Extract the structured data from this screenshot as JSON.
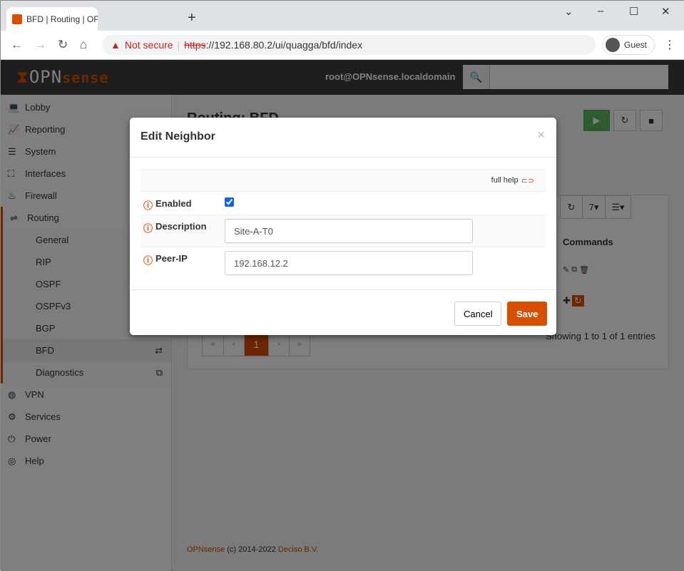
{
  "browser": {
    "tab_title": "BFD | Routing | OPNsense.localdc",
    "new_tab": "+",
    "not_secure": "Not secure",
    "url_scheme": "https",
    "url_rest": "://192.168.80.2/ui/quagga/bfd/index",
    "profile": "Guest"
  },
  "header": {
    "logo": "OPN",
    "logo_accent": "sense",
    "user": "root@OPNsense.localdomain",
    "search_placeholder": ""
  },
  "sidebar": {
    "items": [
      {
        "label": "Lobby",
        "icon": "laptop-icon",
        "glyph": "💻"
      },
      {
        "label": "Reporting",
        "icon": "chart-icon",
        "glyph": "📈"
      },
      {
        "label": "System",
        "icon": "server-icon",
        "glyph": "☰"
      },
      {
        "label": "Interfaces",
        "icon": "sitemap-icon",
        "glyph": "⛶"
      },
      {
        "label": "Firewall",
        "icon": "fire-icon",
        "glyph": "♨"
      },
      {
        "label": "Routing",
        "icon": "routing-icon",
        "glyph": "⇌"
      }
    ],
    "sub": [
      {
        "label": "General"
      },
      {
        "label": "RIP"
      },
      {
        "label": "OSPF"
      },
      {
        "label": "OSPFv3"
      },
      {
        "label": "BGP"
      },
      {
        "label": "BFD",
        "glyph": "⇄"
      },
      {
        "label": "Diagnostics",
        "glyph": "⧉"
      }
    ],
    "items2": [
      {
        "label": "VPN",
        "icon": "globe-icon",
        "glyph": "◍"
      },
      {
        "label": "Services",
        "icon": "cog-icon",
        "glyph": "⚙"
      },
      {
        "label": "Power",
        "icon": "plug-icon",
        "glyph": "⏻"
      },
      {
        "label": "Help",
        "icon": "lifebuoy-icon",
        "glyph": "◎"
      }
    ]
  },
  "main": {
    "title": "Routing: BFD",
    "commands_header": "Commands",
    "page_size": "7",
    "pager": [
      "«",
      "‹",
      "1",
      "›",
      "»"
    ],
    "showing": "Showing 1 to 1 of 1 entries"
  },
  "footer": {
    "brand": "OPNsense",
    "copy": " (c) 2014-2022 ",
    "company": "Deciso B.V."
  },
  "modal": {
    "title": "Edit Neighbor",
    "close": "×",
    "full_help": "full help",
    "fields": [
      {
        "label": "Enabled",
        "checked": true
      },
      {
        "label": "Description",
        "value": "Site-A-T0"
      },
      {
        "label": "Peer-IP",
        "value": "192.168.12.2"
      }
    ],
    "cancel": "Cancel",
    "save": "Save"
  },
  "colors": {
    "accent": "#d94f00",
    "header": "#3c3c3c",
    "start": "#5cb85c"
  }
}
